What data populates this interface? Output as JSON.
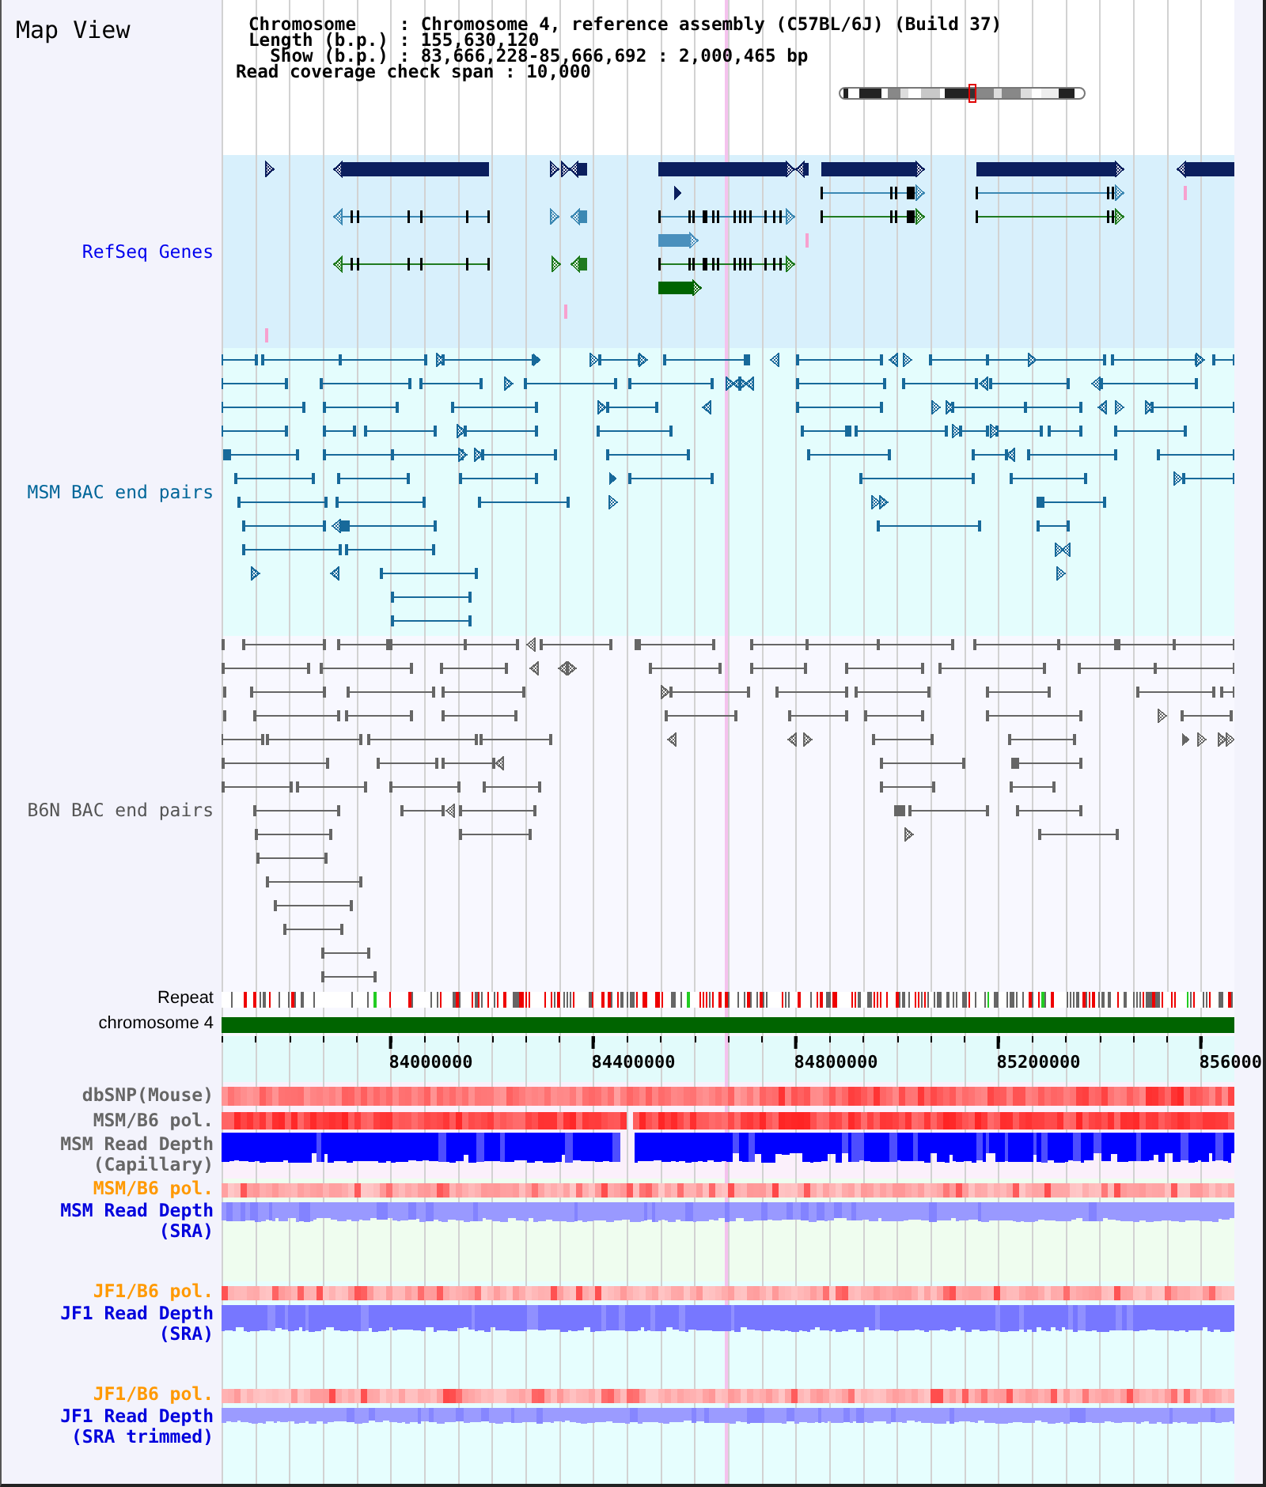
{
  "title": "Map View",
  "info": {
    "lines": [
      "Chromosome    : Chromosome 4, reference assembly (C57BL/6J) (Build 37)",
      "Length (b.p.) : 155,630,120",
      "  Show (b.p.) : 83,666,228-85,666,692 : 2,000,465 bp"
    ],
    "coverage": "Read coverage check span : 10,000"
  },
  "tracks": [
    {
      "kind": "genes",
      "label": "RefSeq Genes",
      "color": "#0000ee"
    },
    {
      "kind": "bac_msm",
      "label": "MSM BAC end pairs",
      "color": "#006699"
    },
    {
      "kind": "bac_b6n",
      "label": "B6N BAC end pairs",
      "color": "#555555"
    },
    {
      "kind": "repeat",
      "label": "Repeat",
      "color": "#000000"
    },
    {
      "kind": "chromosome",
      "label": "chromosome 4",
      "color": "#000000"
    }
  ],
  "axis": {
    "ticks": [
      "84000000",
      "84400000",
      "84800000",
      "85200000",
      "856000"
    ]
  },
  "lower_sections": [
    {
      "tracks": [
        {
          "kind": "snp",
          "label": "dbSNP(Mouse)",
          "color": "#666666"
        },
        {
          "kind": "pol_capillary",
          "label": "MSM/B6 pol.",
          "color": "#666666"
        },
        {
          "kind": "depth_capillary",
          "label": "MSM Read Depth (Capillary)",
          "color": "#666666"
        }
      ]
    },
    {
      "tracks": [
        {
          "kind": "pol",
          "label": "MSM/B6 pol.",
          "color": "#ff9900"
        },
        {
          "kind": "depth",
          "label": "MSM Read Depth (SRA)",
          "color": "#0000dd"
        }
      ]
    },
    {
      "tracks": [
        {
          "kind": "pol",
          "label": "JF1/B6 pol.",
          "color": "#ff9900"
        },
        {
          "kind": "depth",
          "label": "JF1 Read Depth (SRA)",
          "color": "#0000dd"
        },
        {
          "kind": "pol",
          "label": "JF1/B6 pol.",
          "color": "#ff9900"
        },
        {
          "kind": "depth",
          "label": "JF1 Read Depth (SRA trimmed)",
          "color": "#0000dd"
        }
      ]
    }
  ]
}
